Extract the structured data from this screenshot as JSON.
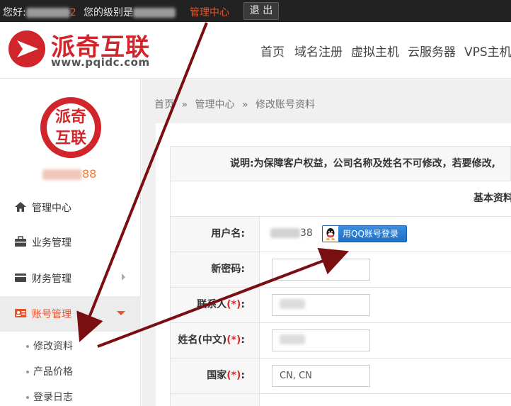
{
  "topbar": {
    "greeting": "您好:",
    "greeting_tail": "2",
    "level_text": "您的级别是",
    "admin_center": "管理中心",
    "logout": "退 出"
  },
  "header": {
    "logo_text": "派奇互联",
    "logo_url": "www.pqidc.com",
    "nav": [
      "首页",
      "域名注册",
      "虚拟主机",
      "云服务器",
      "VPS主机"
    ]
  },
  "sidebar": {
    "avatar_text_top": "派奇",
    "avatar_text_bottom": "互联",
    "username_tail": "88",
    "menu": [
      {
        "label": "管理中心",
        "icon": "home-icon"
      },
      {
        "label": "业务管理",
        "icon": "briefcase-icon"
      },
      {
        "label": "财务管理",
        "icon": "card-icon"
      },
      {
        "label": "账号管理",
        "icon": "id-card-icon"
      }
    ],
    "submenu": [
      "修改资料",
      "产品价格",
      "登录日志"
    ]
  },
  "breadcrumb": [
    "首页",
    "管理中心",
    "修改账号资料"
  ],
  "breadcrumb_sep": "»",
  "form": {
    "notice": "说明:为保障客户权益，公司名称及姓名不可修改，若要修改,",
    "section_title": "基本资料",
    "username_label": "用户名:",
    "username_tail": "38",
    "qq_button": "用QQ账号登录",
    "password_label": "新密码:",
    "contact_label": "联系人",
    "name_label": "姓名(中文)",
    "country_label": "国家",
    "country_value": "CN, CN",
    "required_mark": "(*)",
    "colon": ":"
  },
  "colors": {
    "brand_red": "#d0262b",
    "active_orange": "#e9532b",
    "arrow": "#7a0f12"
  }
}
